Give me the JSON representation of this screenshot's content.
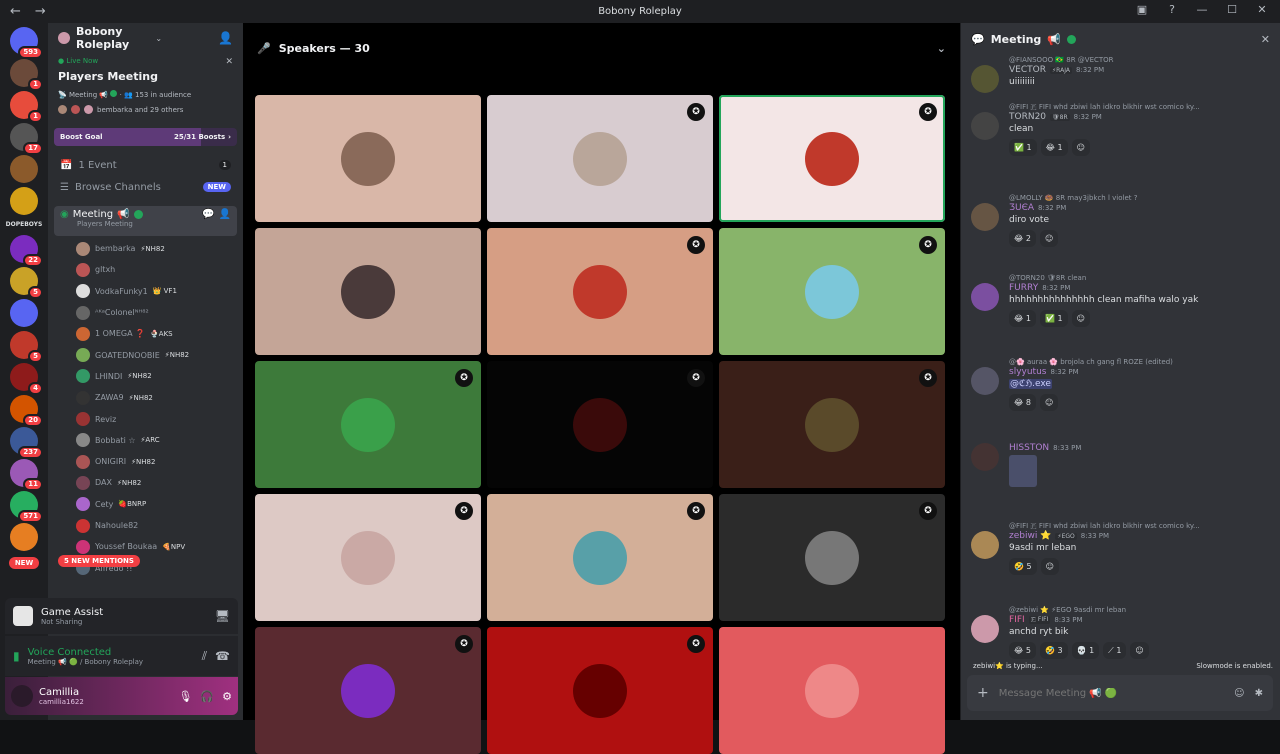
{
  "titlebar": {
    "title": "Bobony Roleplay",
    "back": "←",
    "forward": "→"
  },
  "servers": {
    "items": [
      {
        "badge": "593",
        "color": "#5865f2"
      },
      {
        "badge": "1",
        "color": "#6b4a3a"
      },
      {
        "badge": "1",
        "color": "#e74c3c"
      },
      {
        "badge": "17",
        "color": "#555"
      },
      {
        "badge": "",
        "color": "#8b5a2b"
      },
      {
        "badge": "",
        "color": "#d4a017"
      },
      {
        "badge": "",
        "color": "#1e1f22",
        "text": "DOPEBOYS"
      },
      {
        "badge": "22",
        "color": "#7b2cbf"
      },
      {
        "badge": "5",
        "color": "#c9a227"
      },
      {
        "badge": "",
        "color": "#5865f2"
      },
      {
        "badge": "5",
        "color": "#c0392b"
      },
      {
        "badge": "4",
        "color": "#8e1b1b"
      },
      {
        "badge": "20",
        "color": "#d35400"
      },
      {
        "badge": "237",
        "color": "#3b5998"
      },
      {
        "badge": "11",
        "color": "#9b59b6"
      },
      {
        "badge": "571",
        "color": "#27ae60"
      },
      {
        "badge": "",
        "color": "#e67e22"
      }
    ],
    "new_label": "NEW"
  },
  "guild": {
    "name": "Bobony Roleplay"
  },
  "live": {
    "tag": "Live Now",
    "title": "Players Meeting",
    "channel": "Meeting",
    "audience": "153 in audience",
    "people": "bembarka and 29 others"
  },
  "boost": {
    "label": "Boost Goal",
    "progress": "25/31 Boosts",
    "fraction": 0.806
  },
  "channels": {
    "event": "1 Event",
    "event_count": "1",
    "browse": "Browse Channels",
    "browse_badge": "NEW",
    "voice_name": "Meeting",
    "voice_sub": "Players Meeting"
  },
  "users": [
    {
      "name": "bembarka",
      "tag": "⚡NH82",
      "color": "#a87"
    },
    {
      "name": "gltxh",
      "tag": "",
      "color": "#b55"
    },
    {
      "name": "VodkaFunky1",
      "tag": "👑 VF1",
      "color": "#ddd"
    },
    {
      "name": "ᴬᴷᵃColonelᴺᴴ⁸²",
      "tag": "",
      "color": "#666"
    },
    {
      "name": "1 OMEGA ❓",
      "tag": "🍨AKS",
      "color": "#c63"
    },
    {
      "name": "GOATEDNOOBIE",
      "tag": "⚡NH82",
      "color": "#7a5"
    },
    {
      "name": "LHINDI",
      "tag": "⚡NH82",
      "color": "#396"
    },
    {
      "name": "ZAWA9",
      "tag": "⚡NH82",
      "color": "#333"
    },
    {
      "name": "Reviz",
      "tag": "",
      "color": "#933"
    },
    {
      "name": "Bobbati ☆",
      "tag": "⚡ARC",
      "color": "#888"
    },
    {
      "name": "ONIGIRI",
      "tag": "⚡NH82",
      "color": "#a55"
    },
    {
      "name": "DAX",
      "tag": "⚡NH82",
      "color": "#745"
    },
    {
      "name": "Cety",
      "tag": "🍓BNRP",
      "color": "#a6c"
    },
    {
      "name": "Nahoule82",
      "tag": "",
      "color": "#c33"
    },
    {
      "name": "Youssef Boukaa",
      "tag": "🍕NPV",
      "color": "#c37"
    },
    {
      "name": "Alfredo !!",
      "tag": "",
      "color": "#567"
    }
  ],
  "mentions": "5 NEW MENTIONS",
  "game_assist": {
    "title": "Game Assist",
    "sub": "Not Sharing"
  },
  "voice": {
    "title": "Voice Connected",
    "sub": "Meeting 📢 🟢 / Bobony Roleplay"
  },
  "me": {
    "name": "Camillia",
    "handle": "camillia1622"
  },
  "stage": {
    "speakers": "Speakers — 30"
  },
  "tiles": [
    {
      "bg": "#d9b7a8",
      "av": "#8a6a5a",
      "shield": false,
      "speaking": false
    },
    {
      "bg": "#d8ccd0",
      "av": "#b9a69a",
      "shield": true,
      "speaking": false
    },
    {
      "bg": "#f3e6e6",
      "av": "#c0392b",
      "shield": true,
      "speaking": true
    },
    {
      "bg": "#c4a597",
      "av": "#4a3a3a",
      "shield": false,
      "speaking": false
    },
    {
      "bg": "#d69e84",
      "av": "#c0392b",
      "shield": true,
      "speaking": false
    },
    {
      "bg": "#88b46a",
      "av": "#7cc7d9",
      "shield": true,
      "speaking": false
    },
    {
      "bg": "#3d7a3a",
      "av": "#3aa04a",
      "shield": true,
      "speaking": false
    },
    {
      "bg": "#050505",
      "av": "#3a0a0a",
      "shield": true,
      "speaking": false
    },
    {
      "bg": "#3a1f18",
      "av": "#5a4a2a",
      "shield": true,
      "speaking": false
    },
    {
      "bg": "#ddc9c5",
      "av": "#caa9a5",
      "shield": true,
      "speaking": false
    },
    {
      "bg": "#d3af98",
      "av": "#58a0a8",
      "shield": true,
      "speaking": false
    },
    {
      "bg": "#2b2b2b",
      "av": "#777",
      "shield": true,
      "speaking": false
    },
    {
      "bg": "#5a2a30",
      "av": "#7b2cbf",
      "shield": true,
      "speaking": false
    },
    {
      "bg": "#b01010",
      "av": "#600",
      "shield": true,
      "speaking": false
    },
    {
      "bg": "#e25a5e",
      "av": "#e88",
      "shield": false,
      "speaking": false
    }
  ],
  "chat": {
    "channel": "Meeting",
    "placeholder": "Message Meeting 📢 🟢",
    "typing": "zebiwi⭐ is typing...",
    "slowmode": "Slowmode is enabled.",
    "messages": [
      {
        "reply": "@FIANSOOO 🇧🇷 8R @VECTOR",
        "author": "VECTOR",
        "badge": "⚡RAJA",
        "time": "8:32 PM",
        "body": "uiiiiiiii",
        "color": "#b5bac1",
        "av": "#553",
        "reacts": []
      },
      {
        "reply": "@FIFI 🇫 FIFI whd zbiwi lah idkro blkhir wst comico ky...",
        "author": "TORN20",
        "badge": "🛡8R",
        "time": "8:32 PM",
        "body": "clean",
        "color": "#b5bac1",
        "av": "#444",
        "reacts": [
          "✅ 1",
          "😂 1",
          "☺"
        ]
      },
      {
        "reply": "@LMOLLY 🍩 8R may3jbkch l violet ?",
        "author": "ƷUЄA",
        "badge": "",
        "time": "8:32 PM",
        "body": "diro vote",
        "color": "#b07fd0",
        "av": "#654",
        "reacts": [
          "😂 2",
          "☺"
        ]
      },
      {
        "reply": "@TORN20 🛡8R clean",
        "author": "FURRY",
        "badge": "",
        "time": "8:32 PM",
        "body": "hhhhhhhhhhhhhhh clean mafiha walo yak",
        "color": "#b07fd0",
        "av": "#7b4fa0",
        "reacts": [
          "😂 1",
          "✅ 1",
          "☺"
        ]
      },
      {
        "reply": "@🌸 auraa 🌸 brojola ch gang fl ROZE (edited)",
        "author": "slyyutus",
        "badge": "",
        "time": "8:32 PM",
        "body": "@ℭℌ.exe",
        "color": "#b07fd0",
        "av": "#556",
        "reacts": [
          "😂 8",
          "☺"
        ]
      },
      {
        "reply": "",
        "author": "HISSTON",
        "badge": "",
        "time": "8:33 PM",
        "body": "",
        "color": "#b07fd0",
        "av": "#433",
        "reacts": []
      },
      {
        "reply": "@FIFI 🇫 FIFI whd zbiwi lah idkro blkhir wst comico ky...",
        "author": "zebiwi ⭐",
        "badge": "⚡EGO",
        "time": "8:33 PM",
        "body": "9asdi mr leban",
        "color": "#b07fd0",
        "av": "#a85",
        "reacts": [
          "🤣 5",
          "☺"
        ]
      },
      {
        "reply": "@zebiwi ⭐ ⚡EGO 9asdi mr leban",
        "author": "FIFI",
        "badge": "🇫 FIFI",
        "time": "8:33 PM",
        "body": "anchd ryt bik",
        "color": "#e066a0",
        "av": "#c9a",
        "reacts": [
          "😂 5",
          "🤣 3",
          "💀 1",
          "⟋ 1",
          "☺"
        ]
      }
    ]
  }
}
